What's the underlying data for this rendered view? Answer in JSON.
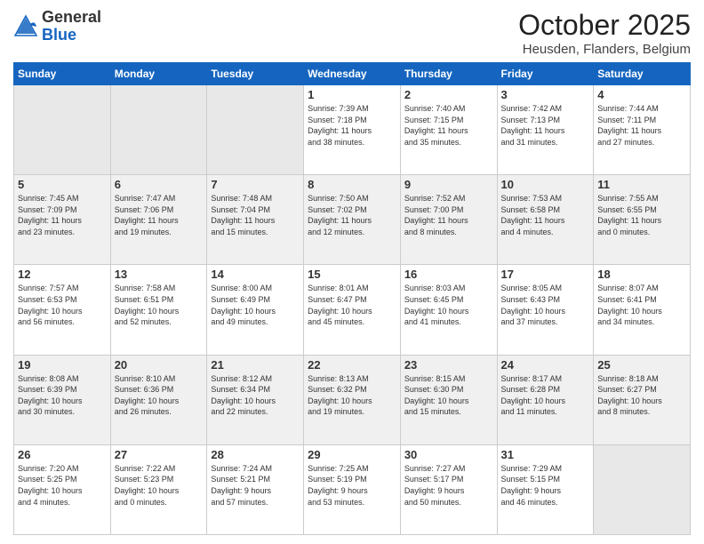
{
  "header": {
    "logo_general": "General",
    "logo_blue": "Blue",
    "month": "October 2025",
    "location": "Heusden, Flanders, Belgium"
  },
  "days_of_week": [
    "Sunday",
    "Monday",
    "Tuesday",
    "Wednesday",
    "Thursday",
    "Friday",
    "Saturday"
  ],
  "weeks": [
    [
      {
        "day": "",
        "info": ""
      },
      {
        "day": "",
        "info": ""
      },
      {
        "day": "",
        "info": ""
      },
      {
        "day": "1",
        "info": "Sunrise: 7:39 AM\nSunset: 7:18 PM\nDaylight: 11 hours\nand 38 minutes."
      },
      {
        "day": "2",
        "info": "Sunrise: 7:40 AM\nSunset: 7:15 PM\nDaylight: 11 hours\nand 35 minutes."
      },
      {
        "day": "3",
        "info": "Sunrise: 7:42 AM\nSunset: 7:13 PM\nDaylight: 11 hours\nand 31 minutes."
      },
      {
        "day": "4",
        "info": "Sunrise: 7:44 AM\nSunset: 7:11 PM\nDaylight: 11 hours\nand 27 minutes."
      }
    ],
    [
      {
        "day": "5",
        "info": "Sunrise: 7:45 AM\nSunset: 7:09 PM\nDaylight: 11 hours\nand 23 minutes."
      },
      {
        "day": "6",
        "info": "Sunrise: 7:47 AM\nSunset: 7:06 PM\nDaylight: 11 hours\nand 19 minutes."
      },
      {
        "day": "7",
        "info": "Sunrise: 7:48 AM\nSunset: 7:04 PM\nDaylight: 11 hours\nand 15 minutes."
      },
      {
        "day": "8",
        "info": "Sunrise: 7:50 AM\nSunset: 7:02 PM\nDaylight: 11 hours\nand 12 minutes."
      },
      {
        "day": "9",
        "info": "Sunrise: 7:52 AM\nSunset: 7:00 PM\nDaylight: 11 hours\nand 8 minutes."
      },
      {
        "day": "10",
        "info": "Sunrise: 7:53 AM\nSunset: 6:58 PM\nDaylight: 11 hours\nand 4 minutes."
      },
      {
        "day": "11",
        "info": "Sunrise: 7:55 AM\nSunset: 6:55 PM\nDaylight: 11 hours\nand 0 minutes."
      }
    ],
    [
      {
        "day": "12",
        "info": "Sunrise: 7:57 AM\nSunset: 6:53 PM\nDaylight: 10 hours\nand 56 minutes."
      },
      {
        "day": "13",
        "info": "Sunrise: 7:58 AM\nSunset: 6:51 PM\nDaylight: 10 hours\nand 52 minutes."
      },
      {
        "day": "14",
        "info": "Sunrise: 8:00 AM\nSunset: 6:49 PM\nDaylight: 10 hours\nand 49 minutes."
      },
      {
        "day": "15",
        "info": "Sunrise: 8:01 AM\nSunset: 6:47 PM\nDaylight: 10 hours\nand 45 minutes."
      },
      {
        "day": "16",
        "info": "Sunrise: 8:03 AM\nSunset: 6:45 PM\nDaylight: 10 hours\nand 41 minutes."
      },
      {
        "day": "17",
        "info": "Sunrise: 8:05 AM\nSunset: 6:43 PM\nDaylight: 10 hours\nand 37 minutes."
      },
      {
        "day": "18",
        "info": "Sunrise: 8:07 AM\nSunset: 6:41 PM\nDaylight: 10 hours\nand 34 minutes."
      }
    ],
    [
      {
        "day": "19",
        "info": "Sunrise: 8:08 AM\nSunset: 6:39 PM\nDaylight: 10 hours\nand 30 minutes."
      },
      {
        "day": "20",
        "info": "Sunrise: 8:10 AM\nSunset: 6:36 PM\nDaylight: 10 hours\nand 26 minutes."
      },
      {
        "day": "21",
        "info": "Sunrise: 8:12 AM\nSunset: 6:34 PM\nDaylight: 10 hours\nand 22 minutes."
      },
      {
        "day": "22",
        "info": "Sunrise: 8:13 AM\nSunset: 6:32 PM\nDaylight: 10 hours\nand 19 minutes."
      },
      {
        "day": "23",
        "info": "Sunrise: 8:15 AM\nSunset: 6:30 PM\nDaylight: 10 hours\nand 15 minutes."
      },
      {
        "day": "24",
        "info": "Sunrise: 8:17 AM\nSunset: 6:28 PM\nDaylight: 10 hours\nand 11 minutes."
      },
      {
        "day": "25",
        "info": "Sunrise: 8:18 AM\nSunset: 6:27 PM\nDaylight: 10 hours\nand 8 minutes."
      }
    ],
    [
      {
        "day": "26",
        "info": "Sunrise: 7:20 AM\nSunset: 5:25 PM\nDaylight: 10 hours\nand 4 minutes."
      },
      {
        "day": "27",
        "info": "Sunrise: 7:22 AM\nSunset: 5:23 PM\nDaylight: 10 hours\nand 0 minutes."
      },
      {
        "day": "28",
        "info": "Sunrise: 7:24 AM\nSunset: 5:21 PM\nDaylight: 9 hours\nand 57 minutes."
      },
      {
        "day": "29",
        "info": "Sunrise: 7:25 AM\nSunset: 5:19 PM\nDaylight: 9 hours\nand 53 minutes."
      },
      {
        "day": "30",
        "info": "Sunrise: 7:27 AM\nSunset: 5:17 PM\nDaylight: 9 hours\nand 50 minutes."
      },
      {
        "day": "31",
        "info": "Sunrise: 7:29 AM\nSunset: 5:15 PM\nDaylight: 9 hours\nand 46 minutes."
      },
      {
        "day": "",
        "info": ""
      }
    ]
  ]
}
